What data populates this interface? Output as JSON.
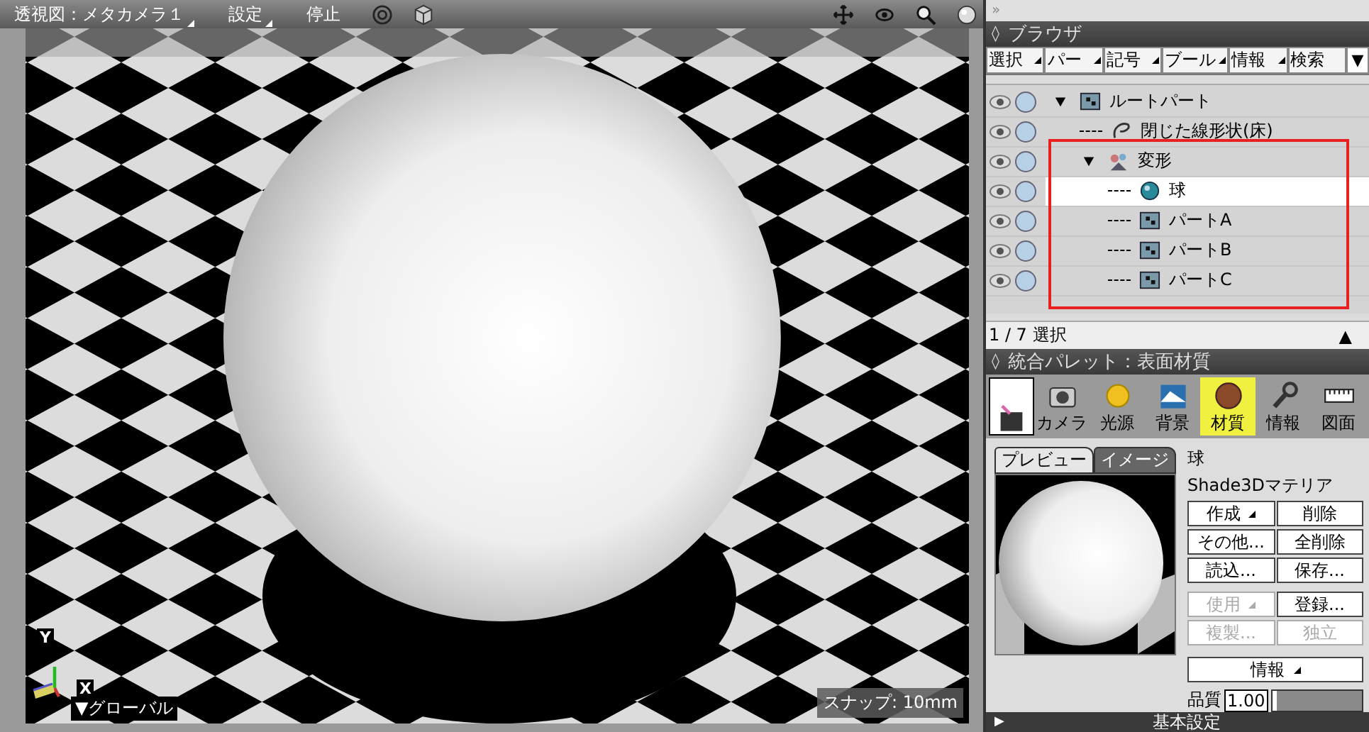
{
  "viewport": {
    "toolbar": [
      {
        "label": "透視図：メタカメラ１",
        "menu": true
      },
      {
        "label": "設定",
        "menu": true
      },
      {
        "label": "停止",
        "menu": false
      }
    ],
    "coordinate_label": "▼グローバル",
    "axis_labels": [
      "Y",
      "X"
    ],
    "snap": "スナップ: 10mm"
  },
  "browser": {
    "collapse": "»",
    "header_icon": "◊",
    "title": "ブラウザ",
    "tabs": [
      {
        "label": "選択",
        "menu": true
      },
      {
        "label": "パー",
        "menu": true
      },
      {
        "label": "記号",
        "menu": true
      },
      {
        "label": "ブール",
        "menu": true
      },
      {
        "label": "情報",
        "menu": true
      },
      {
        "label": "検索",
        "menu": false
      }
    ],
    "tabs_more": "▼",
    "tree": [
      {
        "label": "ルートパート",
        "kind": "part",
        "selected": false,
        "expanded": true,
        "children": [
          {
            "label": "閉じた線形状(床)",
            "kind": "line",
            "selected": false
          },
          {
            "label": "変形",
            "kind": "transform",
            "selected": false,
            "expanded": true,
            "children": [
              {
                "label": "球",
                "kind": "sphere",
                "selected": true
              },
              {
                "label": "パートA",
                "kind": "part",
                "selected": false
              },
              {
                "label": "パートB",
                "kind": "part",
                "selected": false
              },
              {
                "label": "パートC",
                "kind": "part",
                "selected": false
              }
            ]
          }
        ]
      }
    ],
    "status": "1 / 7 選択",
    "status_button": "▲"
  },
  "palette": {
    "header_icon": "◊",
    "title": "統合パレット：表面材質",
    "tabs": [
      {
        "kind": "object",
        "selected": false
      },
      {
        "label": "カメラ",
        "kind": "camera",
        "selected": false
      },
      {
        "label": "光源",
        "kind": "light",
        "selected": false
      },
      {
        "label": "背景",
        "kind": "background",
        "selected": false
      },
      {
        "label": "材質",
        "kind": "material",
        "selected": true
      },
      {
        "label": "情報",
        "kind": "info",
        "selected": false
      },
      {
        "label": "図面",
        "kind": "drawing",
        "selected": false
      }
    ],
    "preview_tabs": [
      {
        "label": "プレビュー",
        "selected": true
      },
      {
        "label": "イメージ",
        "selected": false
      }
    ],
    "object_name": "球",
    "material_type": "Shade3Dマテリア",
    "buttons": [
      {
        "label": "作成",
        "menu": true,
        "disabled": false
      },
      {
        "label": "削除",
        "menu": false,
        "disabled": false
      },
      {
        "label": "その他...",
        "menu": false,
        "disabled": false
      },
      {
        "label": "全削除",
        "menu": false,
        "disabled": false
      },
      {
        "label": "読込...",
        "menu": false,
        "disabled": false
      },
      {
        "label": "保存...",
        "menu": false,
        "disabled": false
      },
      {
        "label": "使用",
        "menu": true,
        "disabled": true
      },
      {
        "label": "登録...",
        "menu": false,
        "disabled": false
      },
      {
        "label": "複製...",
        "menu": false,
        "disabled": true
      },
      {
        "label": "独立",
        "menu": false,
        "disabled": true
      }
    ],
    "info_button": "情報",
    "quality_label": "品質",
    "quality_value": "1.00",
    "quality": {
      "level": 0.02
    },
    "section_arrow": "▶",
    "section": "基本設定"
  }
}
